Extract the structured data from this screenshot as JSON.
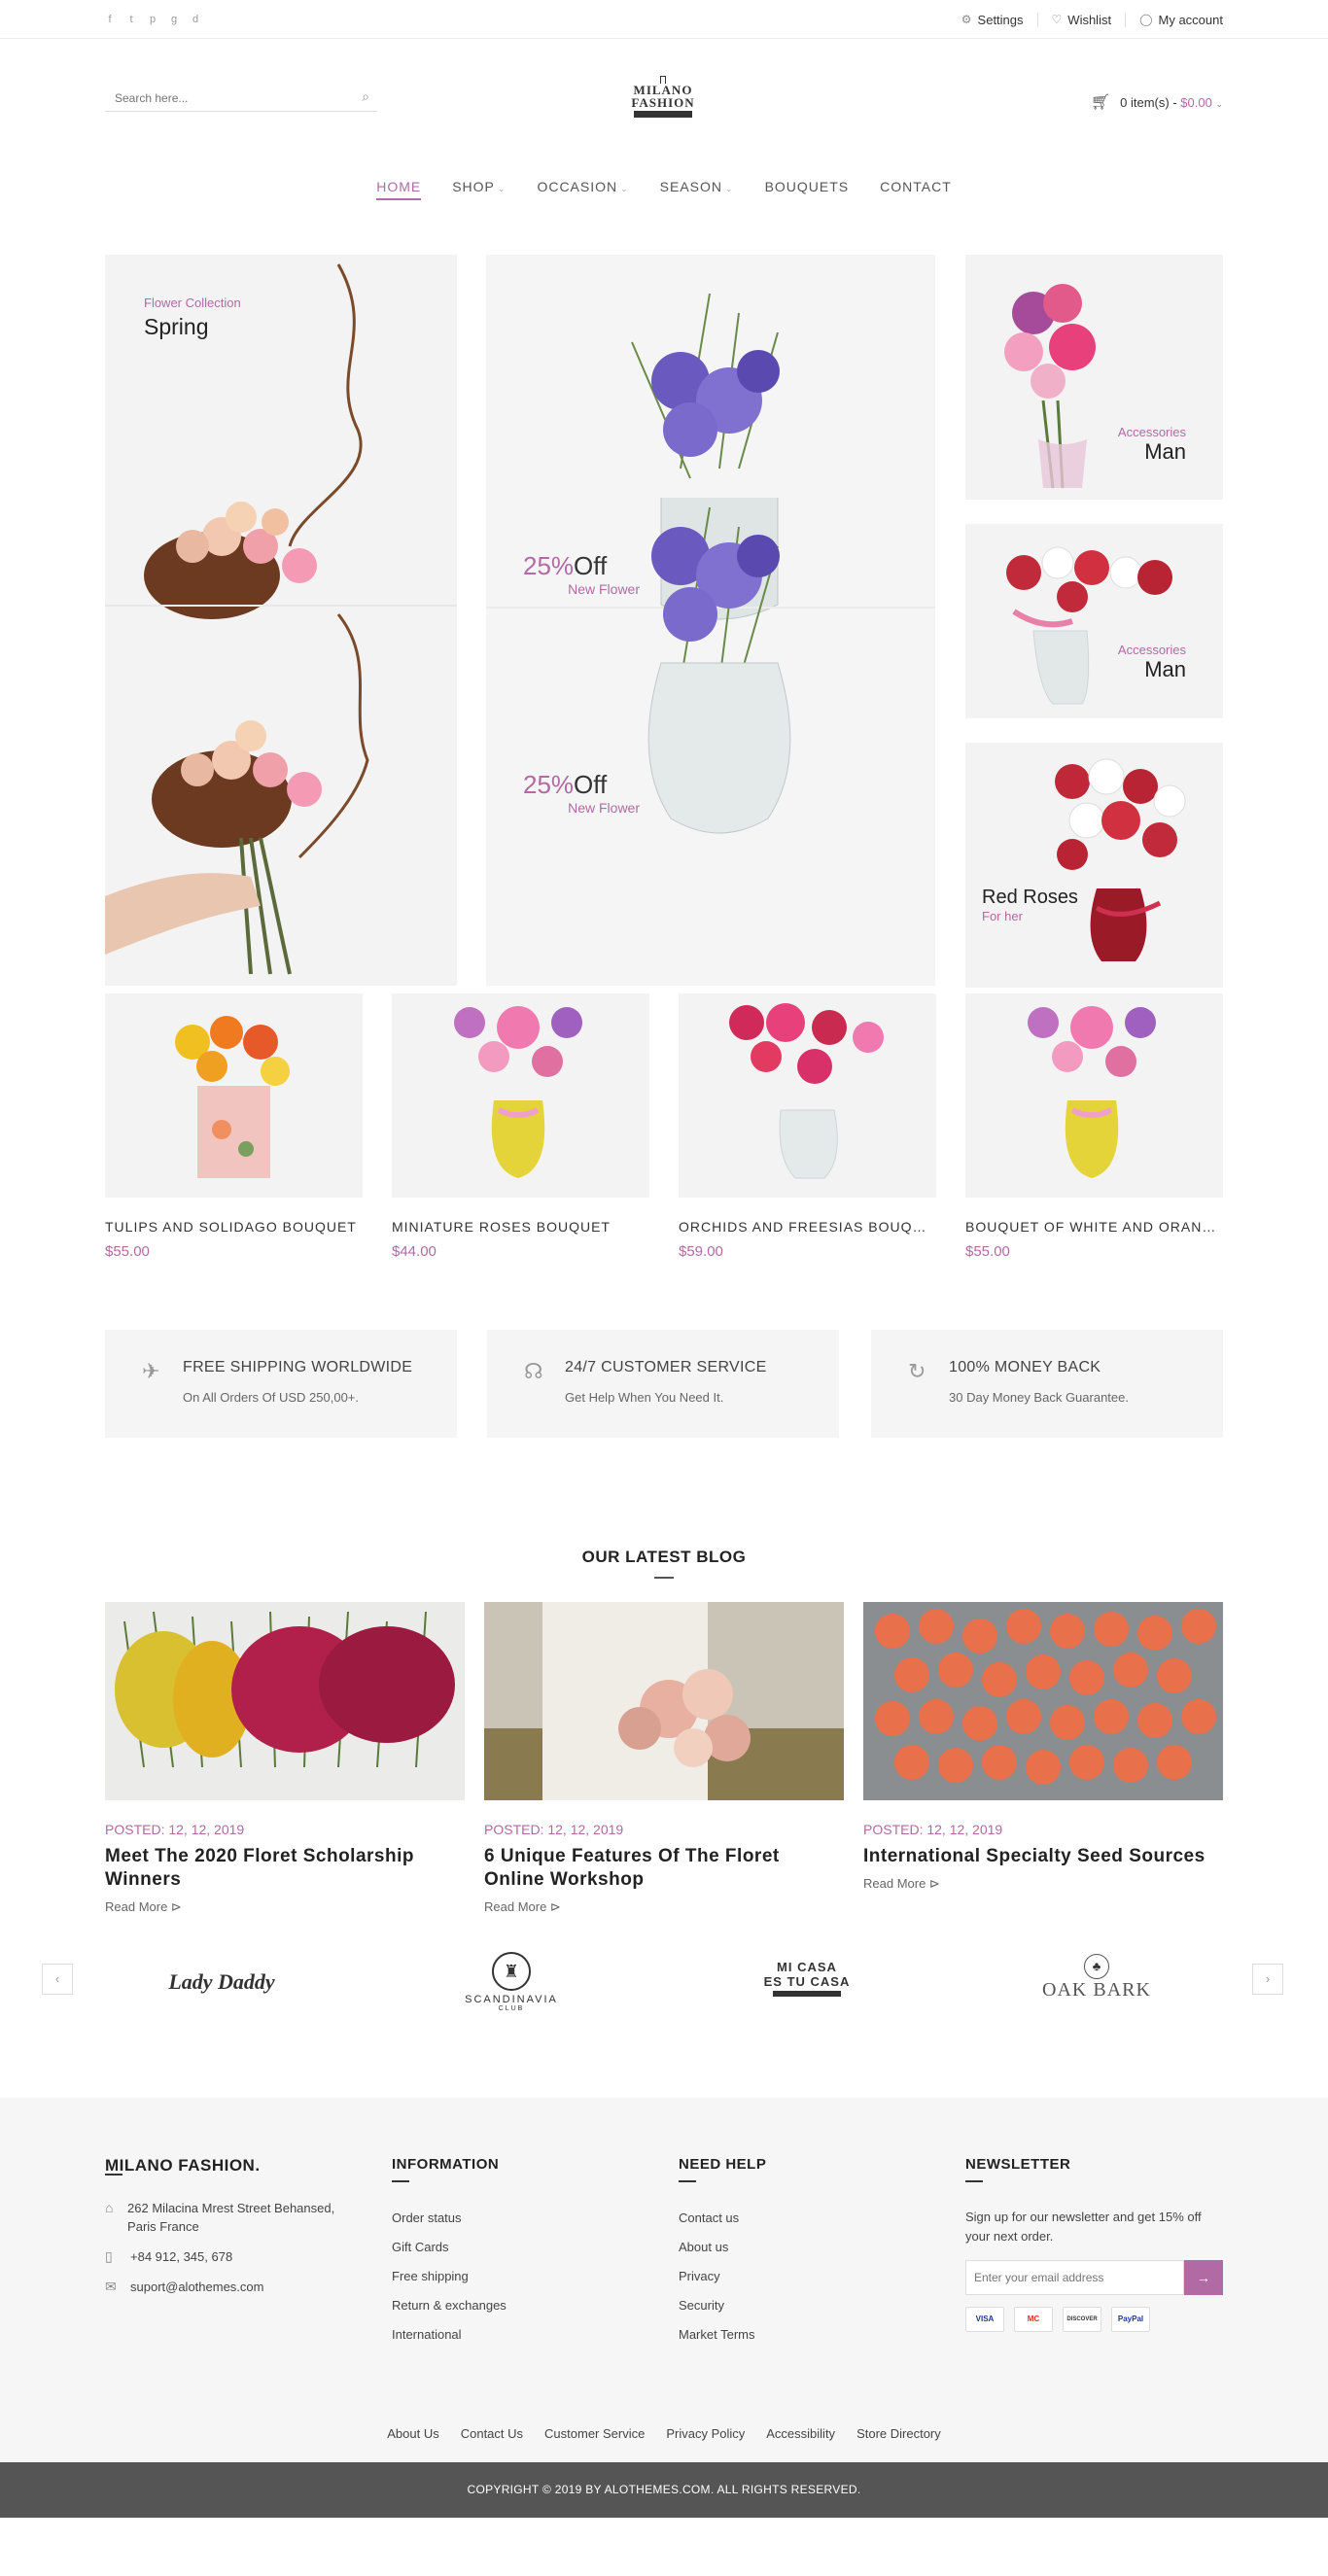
{
  "topbar": {
    "social": [
      "f",
      "t",
      "p",
      "g",
      "d"
    ],
    "social_icons": [
      "facebook-icon",
      "twitter-icon",
      "pinterest-icon",
      "google-plus-icon",
      "dribbble-icon"
    ],
    "settings": "Settings",
    "wishlist": "Wishlist",
    "account": "My account"
  },
  "header": {
    "search_placeholder": "Search here...",
    "logo_line1": "MILANO",
    "logo_line2": "FASHION",
    "cart_items": "0 item(s) -",
    "cart_total": "$0.00"
  },
  "nav": {
    "items": [
      {
        "label": "HOME",
        "active": true
      },
      {
        "label": "SHOP",
        "chevron": true
      },
      {
        "label": "OCCASION",
        "chevron": true
      },
      {
        "label": "SEASON",
        "chevron": true
      },
      {
        "label": "BOUQUETS"
      },
      {
        "label": "CONTACT"
      }
    ]
  },
  "hero": {
    "left": {
      "small": "Flower Collection",
      "big": "Spring"
    },
    "center": [
      {
        "pct": "25%",
        "off": "Off",
        "sub": "New Flower"
      },
      {
        "pct": "25%",
        "off": "Off",
        "sub": "New Flower"
      }
    ],
    "right1": {
      "small": "Accessories",
      "big": "Man"
    },
    "right2": {
      "small": "Accessories",
      "big": "Man"
    },
    "right3": {
      "big": "Red Roses",
      "small": "For her"
    }
  },
  "products": [
    {
      "name": "TULIPS AND SOLIDAGO BOUQUET",
      "price": "$55.00"
    },
    {
      "name": "MINIATURE ROSES BOUQUET",
      "price": "$44.00"
    },
    {
      "name": "ORCHIDS AND FREESIAS BOUQUET",
      "price": "$59.00"
    },
    {
      "name": "BOUQUET OF WHITE AND ORANGE",
      "price": "$55.00"
    }
  ],
  "features": [
    {
      "title": "FREE SHIPPING WORLDWIDE",
      "sub": "On All Orders Of USD 250,00+."
    },
    {
      "title": "24/7 CUSTOMER SERVICE",
      "sub": "Get Help When You Need It."
    },
    {
      "title": "100% MONEY BACK",
      "sub": "30 Day Money Back Guarantee."
    }
  ],
  "blog": {
    "title": "OUR LATEST BLOG",
    "posts": [
      {
        "date": "POSTED: 12, 12, 2019",
        "title": "Meet The 2020 Floret Scholarship Winners",
        "more": "Read More ⊳"
      },
      {
        "date": "POSTED: 12, 12, 2019",
        "title": "6 Unique Features Of The Floret Online Workshop",
        "more": "Read More ⊳"
      },
      {
        "date": "POSTED: 12, 12, 2019",
        "title": "International Specialty Seed Sources",
        "more": "Read More ⊳"
      }
    ]
  },
  "brands": [
    {
      "name": "Lady Daddy"
    },
    {
      "name": "SCANDINAVIA",
      "sub": "CLUB"
    },
    {
      "name": "MI CASA",
      "line2": "ES TU CASA"
    },
    {
      "name": "OAK BARK"
    }
  ],
  "footer": {
    "brand": "MILANO FASHION.",
    "address": "262 Milacina Mrest Street Behansed, Paris France",
    "phone": "+84 912, 345, 678",
    "email": "suport@alothemes.com",
    "info_head": "INFORMATION",
    "info_links": [
      "Order status",
      "Gift Cards",
      "Free shipping",
      "Return & exchanges",
      "International"
    ],
    "help_head": "NEED HELP",
    "help_links": [
      "Contact us",
      "About us",
      "Privacy",
      "Security",
      "Market Terms"
    ],
    "news_head": "NEWSLETTER",
    "news_text": "Sign up for our newsletter and get 15% off your next order.",
    "news_placeholder": "Enter your email address",
    "payments": [
      "VISA",
      "MC",
      "DISCOVER",
      "PayPal"
    ],
    "bottom_links": [
      "About Us",
      "Contact Us",
      "Customer Service",
      "Privacy Policy",
      "Accessibility",
      "Store Directory"
    ],
    "copyright": "COPYRIGHT © 2019 BY ALOTHEMES.COM. ALL RIGHTS RESERVED."
  },
  "colors": {
    "accent": "#b16aa4",
    "footer_bottom": "#555555"
  }
}
